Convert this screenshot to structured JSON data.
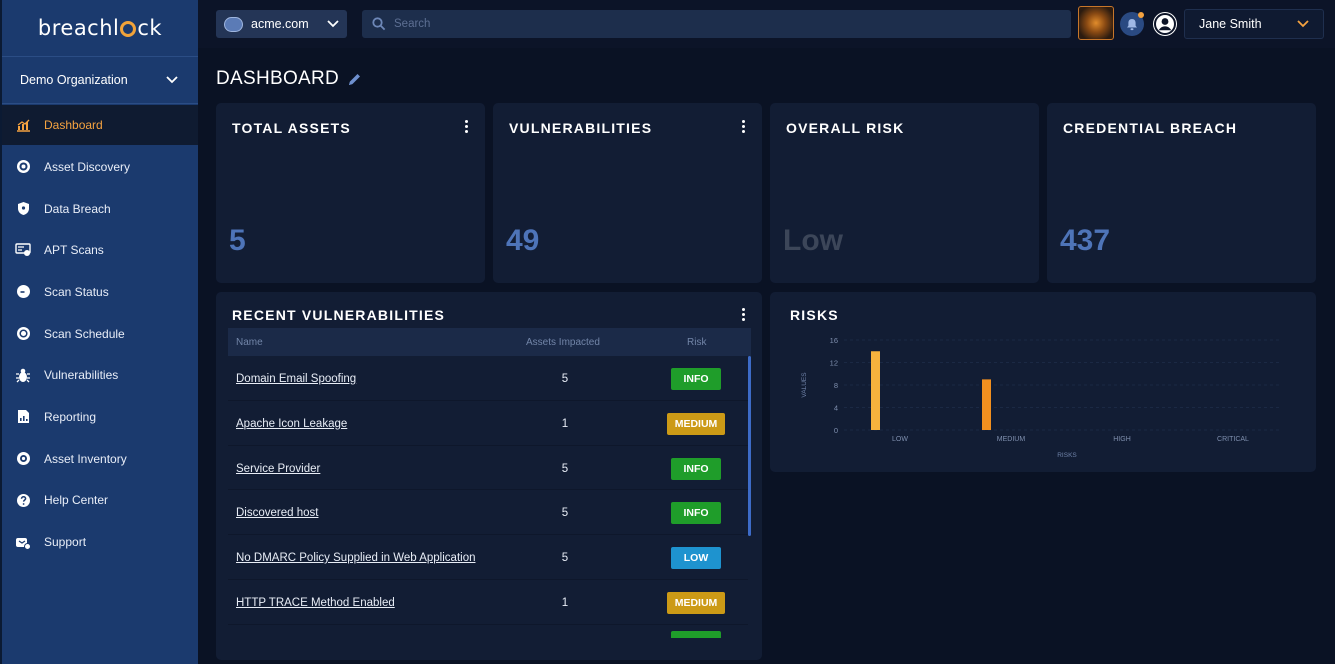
{
  "brand": {
    "name_pre": "breachl",
    "name_post": "ck"
  },
  "sidebar": {
    "org": "Demo Organization",
    "items": [
      {
        "label": "Dashboard",
        "icon": "chart-icon",
        "active": true
      },
      {
        "label": "Asset Discovery",
        "icon": "target-icon"
      },
      {
        "label": "Data Breach",
        "icon": "shield-icon"
      },
      {
        "label": "APT Scans",
        "icon": "apt-icon"
      },
      {
        "label": "Scan Status",
        "icon": "status-icon"
      },
      {
        "label": "Scan Schedule",
        "icon": "schedule-icon"
      },
      {
        "label": "Vulnerabilities",
        "icon": "bug-icon"
      },
      {
        "label": "Reporting",
        "icon": "report-icon"
      },
      {
        "label": "Asset Inventory",
        "icon": "inventory-icon"
      },
      {
        "label": "Help Center",
        "icon": "help-icon"
      },
      {
        "label": "Support",
        "icon": "support-icon"
      }
    ]
  },
  "topbar": {
    "domain": "acme.com",
    "search_placeholder": "Search",
    "user": "Jane Smith"
  },
  "page": {
    "title": "DASHBOARD"
  },
  "stats": {
    "total_assets": {
      "title": "TOTAL ASSETS",
      "value": "5"
    },
    "vulnerabilities": {
      "title": "VULNERABILITIES",
      "value": "49"
    },
    "overall_risk": {
      "title": "OVERALL RISK",
      "value": "Low"
    },
    "credential_breach": {
      "title": "CREDENTIAL BREACH",
      "value": "437"
    }
  },
  "recent": {
    "title": "RECENT VULNERABILITIES",
    "columns": [
      "Name",
      "Assets Impacted",
      "Risk"
    ],
    "rows": [
      {
        "name": "Domain Email Spoofing",
        "assets": "5",
        "risk": "INFO"
      },
      {
        "name": "Apache Icon Leakage",
        "assets": "1",
        "risk": "MEDIUM"
      },
      {
        "name": "Service Provider",
        "assets": "5",
        "risk": "INFO"
      },
      {
        "name": "Discovered host",
        "assets": "5",
        "risk": "INFO"
      },
      {
        "name": "No DMARC Policy Supplied in Web Application ",
        "assets": "5",
        "risk": "LOW"
      },
      {
        "name": "HTTP TRACE Method Enabled",
        "assets": "1",
        "risk": "MEDIUM"
      }
    ]
  },
  "risk_colors": {
    "INFO": "#1f9d2a",
    "MEDIUM": "#cc9a16",
    "LOW": "#1e93cf"
  },
  "chart_data": {
    "type": "bar",
    "title": "RISKS",
    "xlabel": "RISKS",
    "ylabel": "VALUES",
    "categories": [
      "LOW",
      "MEDIUM",
      "HIGH",
      "CRITICAL"
    ],
    "values": [
      14,
      9,
      0,
      0
    ],
    "colors": [
      "#f6b23d",
      "#f2901f",
      "#f2901f",
      "#f2901f"
    ],
    "yticks": [
      0,
      4,
      8,
      12,
      16
    ],
    "ylim": [
      0,
      16
    ],
    "grid": true
  }
}
